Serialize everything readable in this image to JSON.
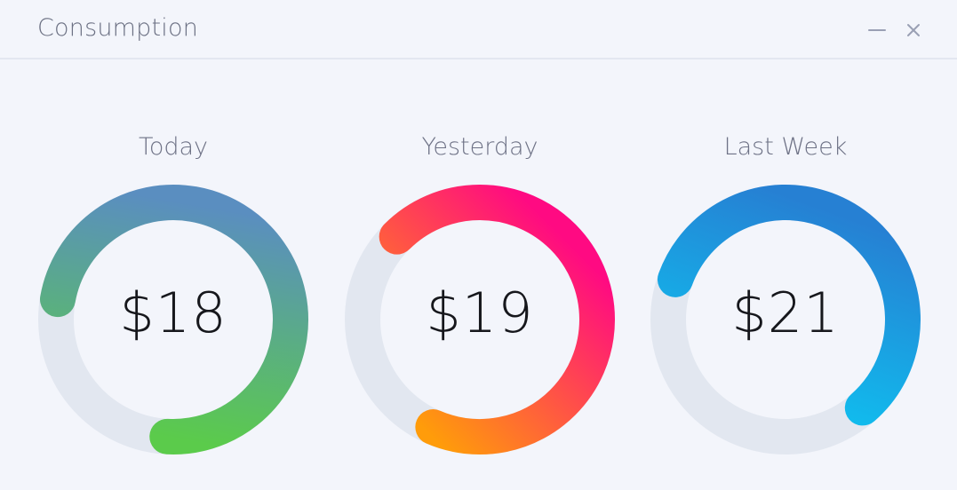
{
  "window": {
    "title": "Consumption",
    "controls": [
      "minimize-icon",
      "close-icon"
    ],
    "control_color": "#9aa0b4"
  },
  "track_color": "#e2e7f0",
  "meters": [
    {
      "id": "today",
      "label": "Today",
      "value": "$18",
      "fill_fraction": 0.73,
      "gradient": [
        "#5bcb4b",
        "#5a8ec0"
      ]
    },
    {
      "id": "yesterday",
      "label": "Yesterday",
      "value": "$19",
      "fill_fraction": 0.69,
      "gradient": [
        "#ff9c0a",
        "#ff0a82"
      ]
    },
    {
      "id": "last-week",
      "label": "Last Week",
      "value": "$21",
      "fill_fraction": 0.58,
      "gradient": [
        "#0cc8f3",
        "#2680d3"
      ]
    }
  ]
}
